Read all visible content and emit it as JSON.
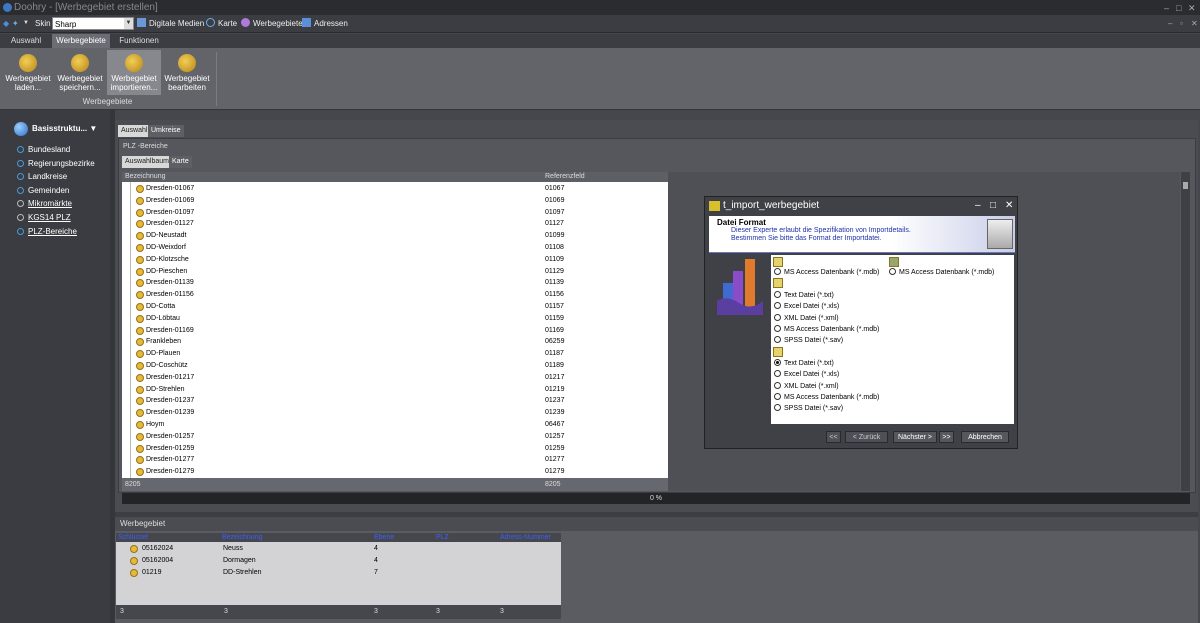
{
  "window": {
    "title": "Doohry - [Werbegebiet erstellen]"
  },
  "quickbar": {
    "skin_label": "Skin",
    "skin_value": "Sharp",
    "links": [
      "Digitale Medien",
      "Karte",
      "Werbegebiete",
      "Adressen"
    ]
  },
  "menu_tabs": [
    "Auswahl",
    "Werbegebiete",
    "Funktionen"
  ],
  "ribbon": {
    "buttons": [
      {
        "l1": "Werbegebiet",
        "l2": "laden..."
      },
      {
        "l1": "Werbegebiet",
        "l2": "speichern..."
      },
      {
        "l1": "Werbegebiet",
        "l2": "importieren..."
      },
      {
        "l1": "Werbegebiet",
        "l2": "bearbeiten"
      }
    ],
    "group_label": "Werbegebiete"
  },
  "sidebar": {
    "header": "Basisstruktu...",
    "items": [
      "Bundesland",
      "Regierungsbezirke",
      "Landkreise",
      "Gemeinden",
      "Mikromärkte",
      "KGS14 PLZ",
      "PLZ-Bereiche"
    ]
  },
  "content": {
    "tabs": [
      "Auswahl",
      "Umkreise"
    ],
    "panel_title": "PLZ -Bereiche",
    "subtabs": [
      "Auswahlbaum",
      "Karte"
    ],
    "grid": {
      "columns": [
        "Bezeichnung",
        "Referenzfeld"
      ],
      "rows": [
        [
          "Dresden-01067",
          "01067"
        ],
        [
          "Dresden-01069",
          "01069"
        ],
        [
          "Dresden-01097",
          "01097"
        ],
        [
          "Dresden-01127",
          "01127"
        ],
        [
          "DD-Neustadt",
          "01099"
        ],
        [
          "DD-Weixdorf",
          "01108"
        ],
        [
          "DD-Klotzsche",
          "01109"
        ],
        [
          "DD-Pieschen",
          "01129"
        ],
        [
          "Dresden-01139",
          "01139"
        ],
        [
          "Dresden-01156",
          "01156"
        ],
        [
          "DD-Cotta",
          "01157"
        ],
        [
          "DD-Löbtau",
          "01159"
        ],
        [
          "Dresden-01169",
          "01169"
        ],
        [
          "Frankleben",
          "06259"
        ],
        [
          "DD-Plauen",
          "01187"
        ],
        [
          "DD-Coschütz",
          "01189"
        ],
        [
          "Dresden-01217",
          "01217"
        ],
        [
          "DD-Strehlen",
          "01219"
        ],
        [
          "Dresden-01237",
          "01237"
        ],
        [
          "Dresden-01239",
          "01239"
        ],
        [
          "Hoym",
          "06467"
        ],
        [
          "Dresden-01257",
          "01257"
        ],
        [
          "Dresden-01259",
          "01259"
        ],
        [
          "Dresden-01277",
          "01277"
        ],
        [
          "Dresden-01279",
          "01279"
        ]
      ],
      "footer": [
        "8205",
        "8205"
      ]
    },
    "progress": "0 %"
  },
  "dialog": {
    "title": "t_import_werbegebiet",
    "heading": "Datei Format",
    "desc1": "Dieser Experte erlaubt die Spezifikation von Importdetails.",
    "desc2": "Bestimmen Sie bitte das Format der Importdatei.",
    "options_left": [
      "MS Access Datenbank (*.mdb)",
      "Text Datei (*.txt)",
      "Excel Datei (*.xls)",
      "XML Datei (*.xml)",
      "MS Access Datenbank (*.mdb)",
      "SPSS Datei (*.sav)",
      "Text Datei (*.txt)",
      "Excel Datei (*.xls)",
      "XML Datei (*.xml)",
      "MS Access Datenbank (*.mdb)",
      "SPSS Datei (*.sav)"
    ],
    "option_right": "MS Access Datenbank (*.mdb)",
    "buttons": {
      "first": "<<",
      "back": "< Zurück",
      "next": "Nächster >",
      "last": ">>",
      "cancel": "Abbrechen"
    }
  },
  "bottom": {
    "title": "Werbegebiet",
    "columns": [
      "Schlüssel",
      "Bezeichnung",
      "Ebene",
      "PLZ",
      "Adress-Nummer"
    ],
    "rows": [
      [
        "05162024",
        "Neuss",
        "4"
      ],
      [
        "05162004",
        "Dormagen",
        "4"
      ],
      [
        "01219",
        "DD-Strehlen",
        "7"
      ]
    ],
    "footer": [
      "3",
      "3",
      "3",
      "3",
      "3"
    ]
  }
}
